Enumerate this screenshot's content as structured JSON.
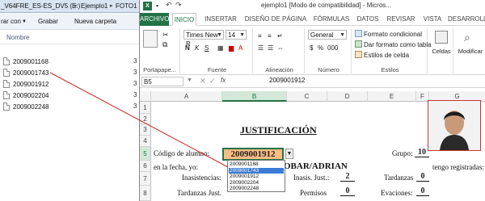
{
  "explorer": {
    "breadcrumb": [
      "_V64FRE_ES-ES_DV5 (E:)",
      "Ejemplo1",
      "FOTO1"
    ],
    "toolbar": [
      "rar con",
      "Grabar",
      "Nueva carpeta"
    ],
    "column_header": "Nombre",
    "files": [
      "2009001168",
      "2009001743",
      "2009001912",
      "2009002204",
      "2009002248"
    ],
    "middle_cut": [
      "3",
      "3",
      "3",
      "3",
      "3"
    ]
  },
  "excel": {
    "title": "ejemplo1 [Modo de compatibilidad] - Micros...",
    "tabs": [
      "ARCHIVO",
      "INICIO",
      "INSERTAR",
      "DISEÑO DE PÁGINA",
      "FÓRMULAS",
      "DATOS",
      "REVISAR",
      "VISTA",
      "DESARROLLA"
    ],
    "active_tab": "INICIO",
    "ribbon": {
      "clipboard_label": "Portapape...",
      "font_name": "Times New R",
      "font_size": "14",
      "font_label": "Fuente",
      "align_label": "Alineación",
      "number_format": "General",
      "number_label": "Número",
      "styles": [
        "Formato condicional",
        "Dar formato como tabla",
        "Estilos de celda"
      ],
      "styles_label": "Estilos",
      "cells_label": "Celdas",
      "modify_label": "Modificar"
    },
    "name_box": "B5",
    "formula_value": "2009001912",
    "columns": [
      "A",
      "B",
      "C",
      "D",
      "E",
      "F",
      "G"
    ],
    "rows": [
      "1",
      "2",
      "3",
      "4",
      "5",
      "6",
      "7",
      "8"
    ],
    "sheet": {
      "heading": "JUSTIFICACIÓN",
      "codigo_label": "Código de alumno:",
      "codigo_value": "2009001912",
      "grupo_label": "Grupo:",
      "grupo_value": "10",
      "fecha_label": "en la fecha,  yo:",
      "name_fragment": "OBAR/ADRIAN",
      "registradas": "tengo registradas:",
      "inasistencias_label": "Inasistencias:",
      "inasis_just_label": "Inasis. Just.:",
      "inasis_just_value": "2",
      "tardanzas_label": "Tardanzas",
      "tardanzas_value": "0",
      "tardanzas_just_label": "Tardanzas Just.",
      "permisos_label": "Permisos",
      "permisos_value": "0",
      "evaciones_label": "Evaciones:",
      "evaciones_value": "0"
    },
    "dropdown": {
      "items": [
        "2009001168",
        "2009001743",
        "2009001912",
        "2009002204",
        "2009002248"
      ],
      "highlighted": 1
    }
  },
  "colors": {
    "excel_green": "#217346",
    "selected_cell": "#f9bd84",
    "highlight": "#3a7bd5",
    "annotation": "#cc2222"
  }
}
